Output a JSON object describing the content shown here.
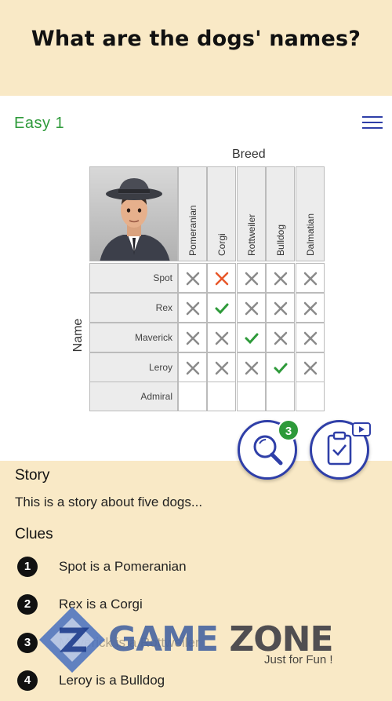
{
  "header": {
    "title": "What are the dogs' names?"
  },
  "level": {
    "label": "Easy  1"
  },
  "grid": {
    "col_axis_label": "Breed",
    "row_axis_label": "Name",
    "columns": [
      "Pomeranian",
      "Corgi",
      "Rottweiler",
      "Bulldog",
      "Dalmatian"
    ],
    "rows": [
      "Spot",
      "Rex",
      "Maverick",
      "Leroy",
      "Admiral"
    ],
    "cells": [
      [
        "x-gray",
        "x-orange",
        "x-gray",
        "x-gray",
        "x-gray"
      ],
      [
        "x-gray",
        "check",
        "x-gray",
        "x-gray",
        "x-gray"
      ],
      [
        "x-gray",
        "x-gray",
        "check",
        "x-gray",
        "x-gray"
      ],
      [
        "x-gray",
        "x-gray",
        "x-gray",
        "check",
        "x-gray"
      ],
      [
        "empty",
        "empty",
        "empty",
        "empty",
        "empty"
      ]
    ]
  },
  "hints": {
    "count": "3"
  },
  "story": {
    "title": "Story",
    "text": "This is a story about five dogs..."
  },
  "clues": {
    "title": "Clues",
    "items": [
      {
        "num": "1",
        "text": "Spot is a Pomeranian"
      },
      {
        "num": "2",
        "text": "Rex is a Corgi"
      },
      {
        "num": "3",
        "text": "Maverick is a Rottweiler"
      },
      {
        "num": "4",
        "text": "Leroy is a Bulldog"
      }
    ]
  },
  "watermark": {
    "brand": "GAME",
    "brand2": "ZONE",
    "tagline": "Just for Fun !"
  },
  "colors": {
    "accent_blue": "#2f3fa8",
    "green": "#2e9a3a",
    "orange": "#e8572a",
    "gray_x": "#8a8a8a",
    "header_bg": "#f9e9c6"
  }
}
